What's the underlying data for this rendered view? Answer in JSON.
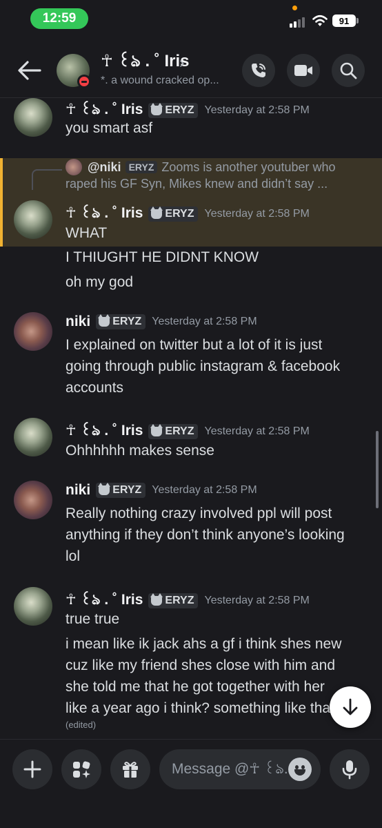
{
  "status_bar": {
    "time": "12:59",
    "battery": "91"
  },
  "header": {
    "name": "☥ ꒰ঌ . ˚ Iris",
    "chevron": "›",
    "status": "*. a wound cracked op..."
  },
  "messages": [
    {
      "author": "☥ ꒰ঌ . ˚ Iris",
      "tag": "ERYZ",
      "time": "Yesterday at 2:58 PM",
      "lines": [
        "you smart asf"
      ]
    },
    {
      "reply": {
        "name": "@niki",
        "tag": "ERYZ",
        "text1": "Zooms is another youtuber who",
        "text2": "raped his GF Syn, Mikes knew and didn’t say ..."
      },
      "author": "☥ ꒰ঌ . ˚ Iris",
      "tag": "ERYZ",
      "time": "Yesterday at 2:58 PM",
      "lines": [
        "WHAT"
      ]
    },
    {
      "lines": [
        "I THIUGHT HE DIDNT KNOW"
      ]
    },
    {
      "lines": [
        "oh my god"
      ]
    },
    {
      "author": "niki",
      "tag": "ERYZ",
      "time": "Yesterday at 2:58 PM",
      "lines": [
        "I explained on twitter but a lot of it is just",
        "going through public instagram & facebook",
        "accounts"
      ]
    },
    {
      "author": "☥ ꒰ঌ . ˚ Iris",
      "tag": "ERYZ",
      "time": "Yesterday at 2:58 PM",
      "lines": [
        "Ohhhhhh makes sense"
      ]
    },
    {
      "author": "niki",
      "tag": "ERYZ",
      "time": "Yesterday at 2:58 PM",
      "lines": [
        "Really nothing crazy involved ppl will post",
        "anything if they don’t think anyone’s looking",
        "lol"
      ]
    },
    {
      "author": "☥ ꒰ঌ . ˚ Iris",
      "tag": "ERYZ",
      "time": "Yesterday at 2:58 PM",
      "lines": [
        "true true"
      ]
    },
    {
      "lines": [
        "i mean like ik jack ahs a gf i think shes new",
        "cuz like my friend shes close with him and",
        "she told me that he got together with her",
        "like a year ago i think? something like that"
      ],
      "edited": "(edited)"
    }
  ],
  "composer": {
    "placeholder": "Message @☥ ꒰ঌ..."
  },
  "icons": {
    "back": "back-arrow-icon",
    "call": "phone-icon",
    "video": "video-camera-icon",
    "search": "search-icon",
    "plus": "plus-icon",
    "apps": "apps-icon",
    "gift": "gift-icon",
    "emoji": "emoji-icon",
    "mic": "microphone-icon",
    "scroll": "arrow-down-icon",
    "dnd": "do-not-disturb-icon",
    "tag": "cat-icon"
  },
  "colors": {
    "highlight_bar": "#f0b232",
    "dnd": "#f23f43",
    "time_pill": "#34c759"
  }
}
